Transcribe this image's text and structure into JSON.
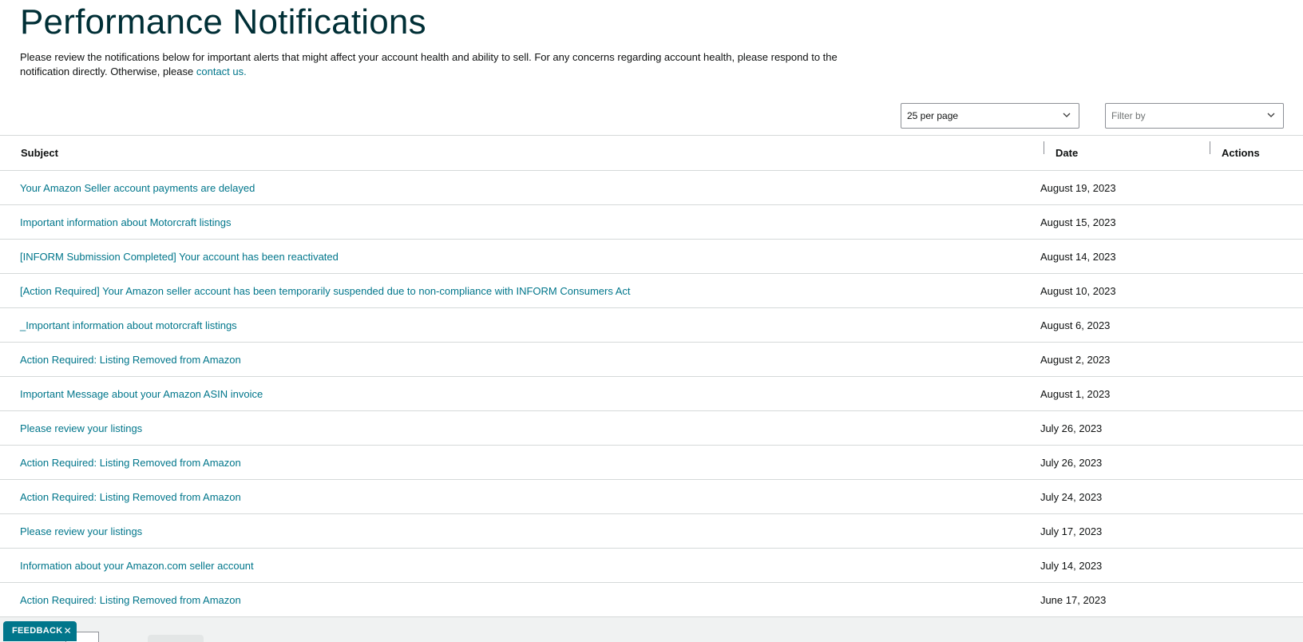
{
  "header": {
    "title": "Performance Notifications",
    "intro_text": "Please review the notifications below for important alerts that might affect your account health and ability to sell. For any concerns regarding account health, please respond to the notification directly. Otherwise, please ",
    "contact_link": "contact us."
  },
  "controls": {
    "per_page": "25 per page",
    "filter_placeholder": "Filter by"
  },
  "table": {
    "columns": {
      "subject": "Subject",
      "date": "Date",
      "actions": "Actions"
    },
    "rows": [
      {
        "subject": "Your Amazon Seller account payments are delayed",
        "date": "August 19, 2023"
      },
      {
        "subject": "Important information about Motorcraft listings",
        "date": "August 15, 2023"
      },
      {
        "subject": "[INFORM Submission Completed] Your account has been reactivated",
        "date": "August 14, 2023"
      },
      {
        "subject": "[Action Required] Your Amazon seller account has been temporarily suspended due to non-compliance with INFORM Consumers Act",
        "date": "August 10, 2023"
      },
      {
        "subject": "_Important information about motorcraft listings",
        "date": "August 6, 2023"
      },
      {
        "subject": "Action Required: Listing Removed from Amazon",
        "date": "August 2, 2023"
      },
      {
        "subject": "Important Message about your Amazon ASIN invoice",
        "date": "August 1, 2023"
      },
      {
        "subject": "Please review your listings",
        "date": "July 26, 2023"
      },
      {
        "subject": "Action Required: Listing Removed from Amazon",
        "date": "July 26, 2023"
      },
      {
        "subject": "Action Required: Listing Removed from Amazon",
        "date": "July 24, 2023"
      },
      {
        "subject": "Please review your listings",
        "date": "July 17, 2023"
      },
      {
        "subject": "Information about your Amazon.com seller account",
        "date": "July 14, 2023"
      },
      {
        "subject": "Action Required: Listing Removed from Amazon",
        "date": "June 17, 2023"
      }
    ]
  },
  "feedback": {
    "label": "FEEDBACK",
    "close": "✕"
  },
  "colors": {
    "link": "#00768b",
    "title": "#002f36",
    "feedback_bg": "#00768b",
    "border": "#d5d9d9"
  },
  "icons": {
    "dropdown": "chevron-down-icon",
    "close": "close-icon"
  }
}
